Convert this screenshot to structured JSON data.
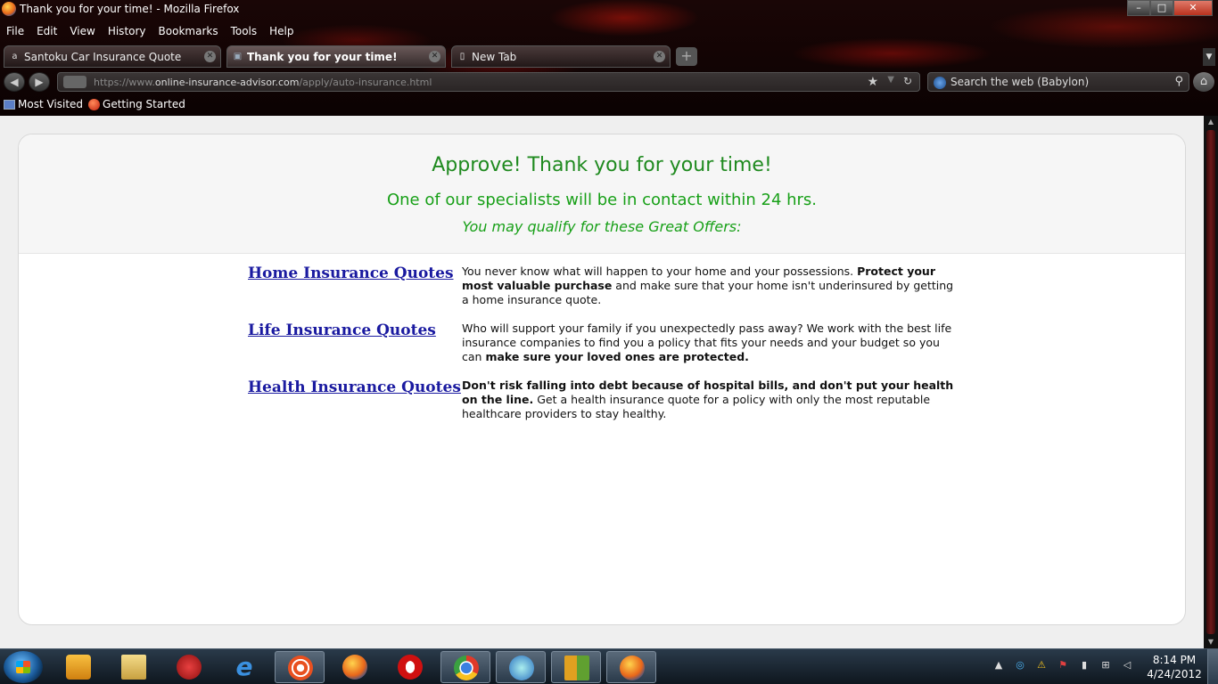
{
  "window": {
    "title": "Thank you for your time! - Mozilla Firefox",
    "controls": {
      "minimize": "–",
      "maximize": "□",
      "close": "✕"
    }
  },
  "menu": [
    "File",
    "Edit",
    "View",
    "History",
    "Bookmarks",
    "Tools",
    "Help"
  ],
  "tabs": [
    {
      "label": "Santoku Car Insurance Quote",
      "icon": "a",
      "active": false
    },
    {
      "label": "Thank you for your time!",
      "icon": "▣",
      "active": true
    },
    {
      "label": "New Tab",
      "icon": "▯",
      "active": false
    }
  ],
  "navbar": {
    "url_prefix": "https://www.",
    "url_host": "online-insurance-advisor.com",
    "url_path": "/apply/auto-insurance.html",
    "search_placeholder": "Search the web (Babylon)"
  },
  "bookmarks": [
    "Most Visited",
    "Getting Started"
  ],
  "page": {
    "heading_main": "Approve! Thank you for your time!",
    "heading_sub": "One of our specialists will be in contact within 24 hrs.",
    "heading_offer": "You may qualify for these Great Offers:",
    "offers": [
      {
        "link": "Home Insurance Quotes",
        "d1": "You never know what will happen to your home and your possessions. ",
        "b1": "Protect your most valuable purchase",
        "d2": " and make sure that your home isn't underinsured by getting a home insurance quote.",
        "b2": "",
        "d3": ""
      },
      {
        "link": "Life Insurance Quotes",
        "d1": "Who will support your family if you unexpectedly pass away? We work with the best life insurance companies to find you a policy that fits your needs and your budget so you can ",
        "b1": "make sure your loved ones are protected.",
        "d2": "",
        "b2": "",
        "d3": ""
      },
      {
        "link": "Health Insurance Quotes",
        "d1": "",
        "b1": "Don't risk falling into debt because of hospital bills, and don't put your health on the line.",
        "d2": " Get a health insurance quote for a policy with only the most reputable healthcare providers to stay healthy.",
        "b2": "",
        "d3": ""
      }
    ]
  },
  "taskbar": {
    "apps": [
      {
        "name": "windows-media-player",
        "color": "#f0a020"
      },
      {
        "name": "windows-explorer",
        "color": "#e8c060"
      },
      {
        "name": "avast",
        "color": "#d02020"
      },
      {
        "name": "internet-explorer",
        "color": "#2a80d0"
      },
      {
        "name": "orange-app",
        "color": "#e85020"
      },
      {
        "name": "firefox",
        "color": "#e87a1a"
      },
      {
        "name": "opera",
        "color": "#d01010"
      },
      {
        "name": "chrome",
        "color": "#3aa040"
      },
      {
        "name": "cyberlink",
        "color": "#2a70c0"
      },
      {
        "name": "winamp-like",
        "color": "#c04a1a"
      },
      {
        "name": "firefox-active",
        "color": "#e87a1a"
      }
    ],
    "time": "8:14 PM",
    "date": "4/24/2012"
  }
}
